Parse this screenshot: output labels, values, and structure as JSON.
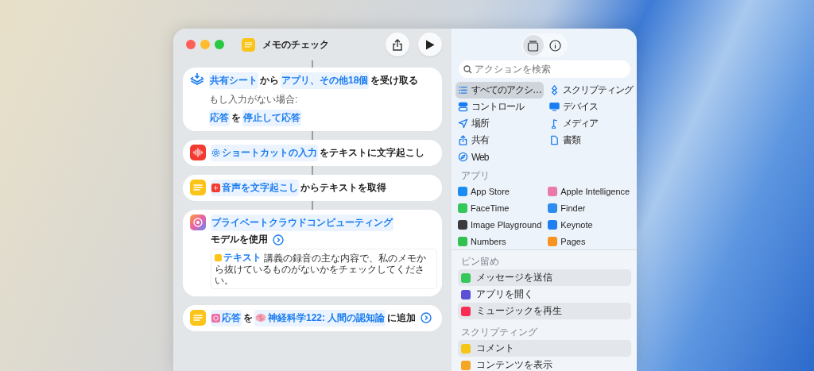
{
  "window": {
    "title": "メモのチェック"
  },
  "actions": [
    {
      "kind": "receive",
      "lines": [
        [
          {
            "kind": "token",
            "text": "共有シート"
          },
          {
            "kind": "text",
            "text": "から"
          },
          {
            "kind": "token",
            "text": "アプリ、その他18個"
          },
          {
            "kind": "text",
            "text": "を受け取る"
          }
        ],
        [
          {
            "kind": "note",
            "text": "もし入力がない場合:"
          }
        ],
        [
          {
            "kind": "token",
            "text": "応答"
          },
          {
            "kind": "text",
            "text": "を"
          },
          {
            "kind": "token",
            "text": "停止して応答"
          }
        ]
      ],
      "details": false
    },
    {
      "kind": "transcribe",
      "lines": [
        [
          {
            "kind": "input",
            "text": "ショートカットの入力"
          },
          {
            "kind": "text",
            "text": "をテキストに文字起こし"
          }
        ]
      ],
      "details": false
    },
    {
      "kind": "gettext",
      "lines": [
        [
          {
            "kind": "audio",
            "text": "音声を文字起こし"
          },
          {
            "kind": "text",
            "text": "からテキストを取得"
          }
        ]
      ],
      "details": false
    },
    {
      "kind": "model",
      "lines": [
        [
          {
            "kind": "token",
            "text": "プライベートクラウドコンピューティング"
          },
          {
            "kind": "text",
            "text": "モデルを使用"
          }
        ]
      ],
      "prompt": {
        "label": "テキスト",
        "text": "講義の録音の主な内容で、私のメモから抜けているものがないかをチェックしてください。"
      },
      "details": true
    },
    {
      "kind": "append",
      "lines": [
        [
          {
            "kind": "response",
            "text": "応答"
          },
          {
            "kind": "text",
            "text": "を"
          },
          {
            "kind": "topic",
            "text": "神経科学122: 人間の認知論"
          },
          {
            "kind": "text",
            "text": "に追加"
          }
        ]
      ],
      "details": true
    }
  ],
  "library": {
    "tabs": [
      {
        "kind": "actions",
        "selected": true
      },
      {
        "kind": "info",
        "selected": false
      }
    ],
    "search": {
      "placeholder": "アクションを検索"
    },
    "categories": [
      {
        "label": "すべてのアクシ…",
        "kind": "list",
        "selected": true
      },
      {
        "label": "スクリプティング",
        "kind": "scripting",
        "selected": false
      },
      {
        "label": "コントロール",
        "kind": "control",
        "selected": false
      },
      {
        "label": "デバイス",
        "kind": "device",
        "selected": false
      },
      {
        "label": "場所",
        "kind": "location",
        "selected": false
      },
      {
        "label": "メディア",
        "kind": "media",
        "selected": false
      },
      {
        "label": "共有",
        "kind": "share",
        "selected": false
      },
      {
        "label": "書類",
        "kind": "document",
        "selected": false
      },
      {
        "label": "Web",
        "kind": "web",
        "selected": false
      }
    ],
    "apps": {
      "heading": "アプリ",
      "items": [
        {
          "label": "App Store",
          "color": "#1a8cf2"
        },
        {
          "label": "Apple Intelligence",
          "color": "#e879a8"
        },
        {
          "label": "FaceTime",
          "color": "#34c759"
        },
        {
          "label": "Finder",
          "color": "#2e8bef"
        },
        {
          "label": "Image Playground",
          "color": "#3a3a3c"
        },
        {
          "label": "Keynote",
          "color": "#1f7ff0"
        },
        {
          "label": "Numbers",
          "color": "#30c14e"
        },
        {
          "label": "Pages",
          "color": "#f7931e"
        }
      ]
    },
    "pinned": {
      "heading": "ピン留め",
      "items": [
        {
          "label": "メッセージを送信",
          "color": "#34c759",
          "highlighted": true
        },
        {
          "label": "アプリを開く",
          "color": "#5b4fd6",
          "highlighted": false
        },
        {
          "label": "ミュージックを再生",
          "color": "#fa2d55",
          "highlighted": true
        }
      ]
    },
    "scripting": {
      "heading": "スクリプティング",
      "items": [
        {
          "label": "コメント",
          "color": "#f5c518",
          "highlighted": true
        },
        {
          "label": "コンテンツを表示",
          "color": "#f5a623",
          "highlighted": false
        }
      ]
    }
  }
}
